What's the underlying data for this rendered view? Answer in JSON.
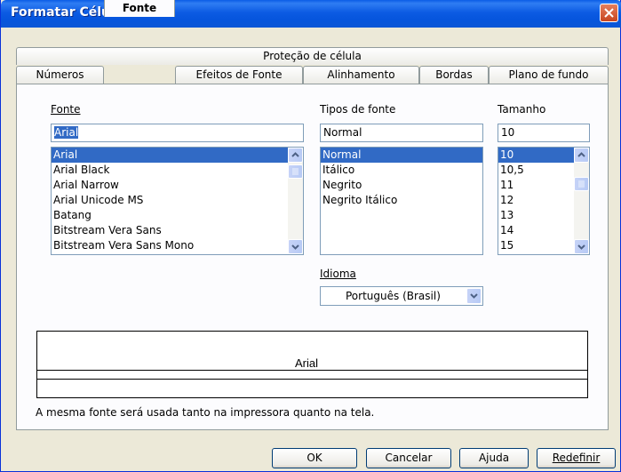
{
  "window": {
    "title": "Formatar Células"
  },
  "tabs_row1": [
    {
      "label": "Proteção de célula"
    }
  ],
  "tabs_row2": [
    {
      "label": "Números"
    },
    {
      "label": "Fonte",
      "active": true
    },
    {
      "label": "Efeitos de Fonte"
    },
    {
      "label": "Alinhamento"
    },
    {
      "label": "Bordas"
    },
    {
      "label": "Plano de fundo"
    }
  ],
  "font": {
    "label": "Fonte",
    "value": "Arial",
    "items": [
      "Arial",
      "Arial Black",
      "Arial Narrow",
      "Arial Unicode MS",
      "Batang",
      "Bitstream Vera Sans",
      "Bitstream Vera Sans Mono"
    ]
  },
  "style": {
    "label": "Tipos de fonte",
    "value": "Normal",
    "items": [
      "Normal",
      "Itálico",
      "Negrito",
      "Negrito Itálico"
    ]
  },
  "size": {
    "label": "Tamanho",
    "value": "10",
    "items": [
      "10",
      "10,5",
      "11",
      "12",
      "13",
      "14",
      "15"
    ]
  },
  "language": {
    "label": "Idioma",
    "value": "Português (Brasil)"
  },
  "preview": {
    "text": "Arial"
  },
  "info_text": "A mesma fonte será usada tanto na impressora quanto na tela.",
  "buttons": {
    "ok": "OK",
    "cancel": "Cancelar",
    "help": "Ajuda",
    "reset": "Redefinir"
  }
}
